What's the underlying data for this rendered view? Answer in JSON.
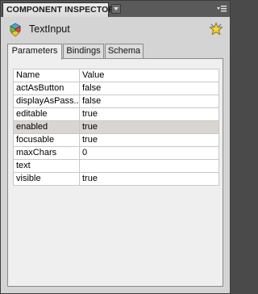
{
  "panel": {
    "title": "COMPONENT INSPECTOR"
  },
  "component": {
    "name": "TextInput",
    "icon": "component-icon"
  },
  "tabs": [
    {
      "label": "Parameters",
      "active": true
    },
    {
      "label": "Bindings",
      "active": false
    },
    {
      "label": "Schema",
      "active": false
    }
  ],
  "table": {
    "headers": {
      "name": "Name",
      "value": "Value"
    },
    "rows": [
      {
        "name": "actAsButton",
        "value": "false"
      },
      {
        "name": "displayAsPass...",
        "value": "false"
      },
      {
        "name": "editable",
        "value": "true"
      },
      {
        "name": "enabled",
        "value": "true",
        "selected": true
      },
      {
        "name": "focusable",
        "value": "true"
      },
      {
        "name": "maxChars",
        "value": "0"
      },
      {
        "name": "text",
        "value": ""
      },
      {
        "name": "visible",
        "value": "true"
      }
    ]
  },
  "colors": {
    "panel_bg": "#d4d4d4",
    "titlebar_bg": "#5a5a5a",
    "selected_row": "#d9d6d1"
  }
}
